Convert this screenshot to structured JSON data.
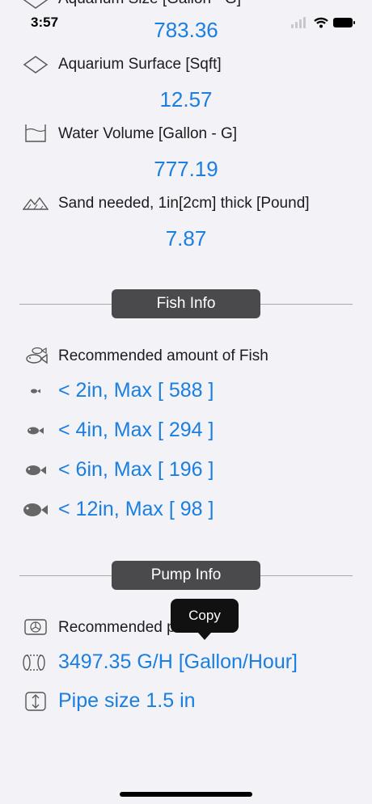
{
  "status_bar": {
    "time": "3:57"
  },
  "aquarium": {
    "size_label_partial": "Aquarium Size [Gallon - G]",
    "size_value": "783.36",
    "surface_label": "Aquarium Surface [Sqft]",
    "surface_value": "12.57",
    "volume_label": "Water Volume [Gallon - G]",
    "volume_value": "777.19",
    "sand_label": "Sand needed, 1in[2cm] thick [Pound]",
    "sand_value": "7.87"
  },
  "fish_info": {
    "section_title": "Fish Info",
    "recommended_label": "Recommended amount of Fish",
    "rows": [
      {
        "text": "< 2in, Max [ 588 ]",
        "icon": "fish-tiny-icon"
      },
      {
        "text": "< 4in, Max [ 294 ]",
        "icon": "fish-small-icon"
      },
      {
        "text": "< 6in, Max [ 196 ]",
        "icon": "fish-medium-icon"
      },
      {
        "text": "< 12in, Max [ 98 ]",
        "icon": "fish-large-icon"
      }
    ]
  },
  "pump_info": {
    "section_title": "Pump Info",
    "recommended_label_partial": "Recommended p",
    "flow_value": "3497.35 G/H [Gallon/Hour]",
    "pipe_value": "Pipe size 1.5 in"
  },
  "tooltip": {
    "label": "Copy"
  },
  "colors": {
    "accent": "#1a7fe0",
    "pill_bg": "#4a4a4c",
    "background": "#f2f2f7"
  }
}
